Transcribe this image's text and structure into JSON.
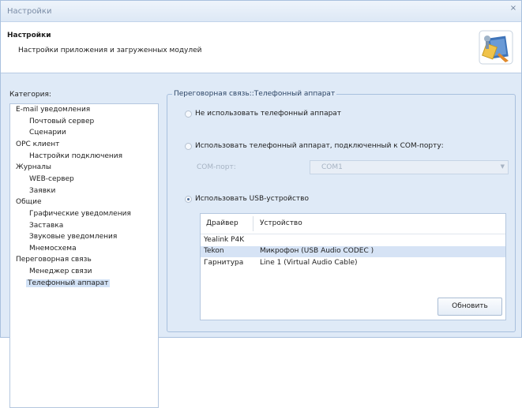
{
  "window": {
    "title": "Настройки",
    "close_glyph": "×"
  },
  "header": {
    "title": "Настройки",
    "subtitle": "Настройки приложения и загруженных модулей",
    "icon": "settings-tools-icon"
  },
  "categories": {
    "label": "Категория:",
    "items": [
      {
        "label": "E-mail уведомления"
      },
      {
        "label": "Почтовый сервер"
      },
      {
        "label": "Сценарии"
      },
      {
        "label": "OPC клиент"
      },
      {
        "label": "Настройки подключения"
      },
      {
        "label": "Журналы"
      },
      {
        "label": "WEB-сервер"
      },
      {
        "label": "Заявки"
      },
      {
        "label": "Общие"
      },
      {
        "label": "Графические уведомления"
      },
      {
        "label": "Заставка"
      },
      {
        "label": "Звуковые уведомления"
      },
      {
        "label": "Мнемосхема"
      },
      {
        "label": "Переговорная связь"
      },
      {
        "label": "Менеджер связи"
      },
      {
        "label": "Телефонный аппарат"
      }
    ],
    "selected_index": 15
  },
  "panel": {
    "group_title": "Переговорная связь::Телефонный аппарат",
    "options": [
      {
        "label": "Не использовать телефонный аппарат",
        "checked": false
      },
      {
        "label": "Использовать телефонный аппарат, подключенный к COM-порту:",
        "checked": false
      },
      {
        "label": "Использовать USB-устройство",
        "checked": true
      }
    ],
    "com_port": {
      "label": "COM-порт:",
      "value": "COM1"
    },
    "devices": {
      "columns": [
        "Драйвер",
        "Устройство"
      ],
      "rows": [
        {
          "driver": "Yealink P4K",
          "device": ""
        },
        {
          "driver": "Tekon",
          "device": "Микрофон (USB Audio CODEC )"
        },
        {
          "driver": "Гарнитура",
          "device": "Line 1 (Virtual Audio Cable)"
        }
      ],
      "selected_index": 1
    },
    "refresh_label": "Обновить"
  }
}
